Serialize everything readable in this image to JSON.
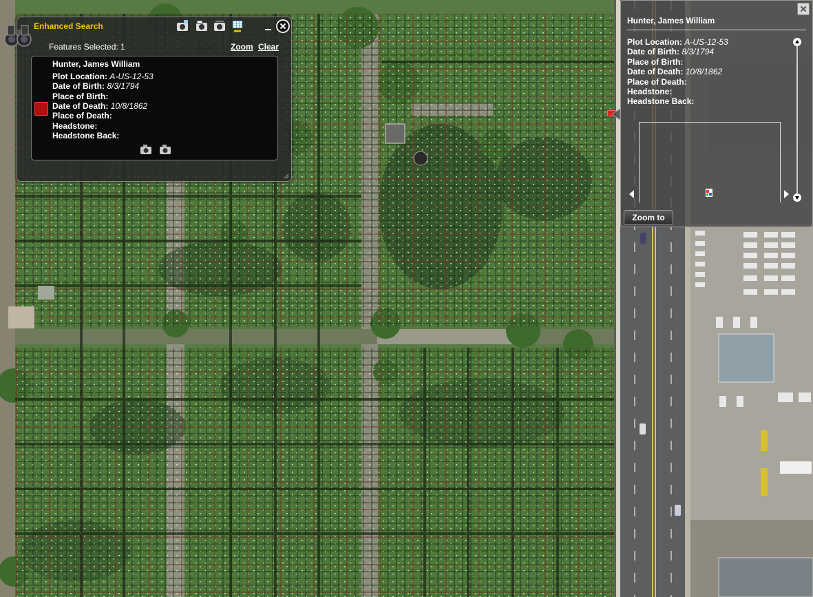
{
  "search_widget": {
    "title": "Enhanced Search",
    "features_selected": "Features Selected: 1",
    "zoom_link": "Zoom",
    "clear_link": "Clear",
    "tool_icons": [
      "search-by-layer-icon",
      "search-by-graphic-icon",
      "search-by-text-icon",
      "results-table-icon"
    ],
    "result": {
      "name": "Hunter, James William",
      "plot_location_label": "Plot Location:",
      "plot_location_value": "A-US-12-53",
      "dob_label": "Date of Birth:",
      "dob_value": "8/3/1794",
      "pob_label": "Place of Birth:",
      "dod_label": "Date of Death:",
      "dod_value": "10/8/1862",
      "pod_label": "Place of Death:",
      "headstone_label": "Headstone:",
      "headstone_back_label": "Headstone Back:"
    },
    "colors": {
      "title": "#f2c400",
      "swatch": "#b01010"
    }
  },
  "popup": {
    "title": "Hunter, James William",
    "plot_location_label": "Plot Location:",
    "plot_location_value": "A-US-12-53",
    "dob_label": "Date of Birth:",
    "dob_value": "8/3/1794",
    "pob_label": "Place of Birth:",
    "dod_label": "Date of Death:",
    "dod_value": "10/8/1862",
    "pod_label": "Place of Death:",
    "headstone_label": "Headstone:",
    "headstone_back_label": "Headstone Back:",
    "zoom_to_label": "Zoom to"
  }
}
